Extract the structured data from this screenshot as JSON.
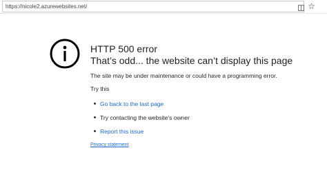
{
  "browser": {
    "url": "https://nicole2.azurewebsites.net/",
    "reader_icon": "reading-view-icon",
    "favorite_icon": "favorite-star-icon"
  },
  "error": {
    "icon": "info-icon",
    "title": "HTTP 500 error",
    "subtitle": "That’s odd... the website can’t display this page",
    "description": "The site may be under maintenance or could have a programming error.",
    "try_this": "Try this",
    "suggestions": [
      {
        "label": "Go back to the last page",
        "is_link": true
      },
      {
        "label": "Try contacting the website’s owner",
        "is_link": false
      },
      {
        "label": "Report this issue",
        "is_link": true
      }
    ],
    "privacy_link": "Privacy statement"
  },
  "colors": {
    "link": "#1a6ad4",
    "text": "#1f1f1f"
  }
}
